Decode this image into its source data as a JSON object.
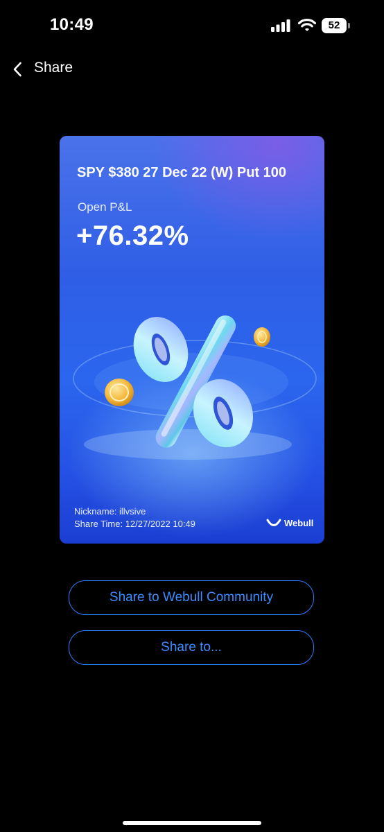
{
  "status_bar": {
    "time": "10:49",
    "battery": "52"
  },
  "nav": {
    "title": "Share",
    "back_icon": "chevron-left-icon"
  },
  "card": {
    "contract": "SPY $380 27 Dec 22 (W) Put 100",
    "pnl_label": "Open P&L",
    "pnl_value": "+76.32%",
    "nickname": "Nickname: illvsive",
    "share_time": "Share Time: 12/27/2022 10:49",
    "logo_text": "Webull",
    "artwork": "percent-sign-with-coins"
  },
  "buttons": {
    "community": "Share to Webull Community",
    "share_to": "Share to..."
  },
  "colors": {
    "background": "#000000",
    "accent": "#2c7fff",
    "card_blue": "#2f5ee6"
  }
}
